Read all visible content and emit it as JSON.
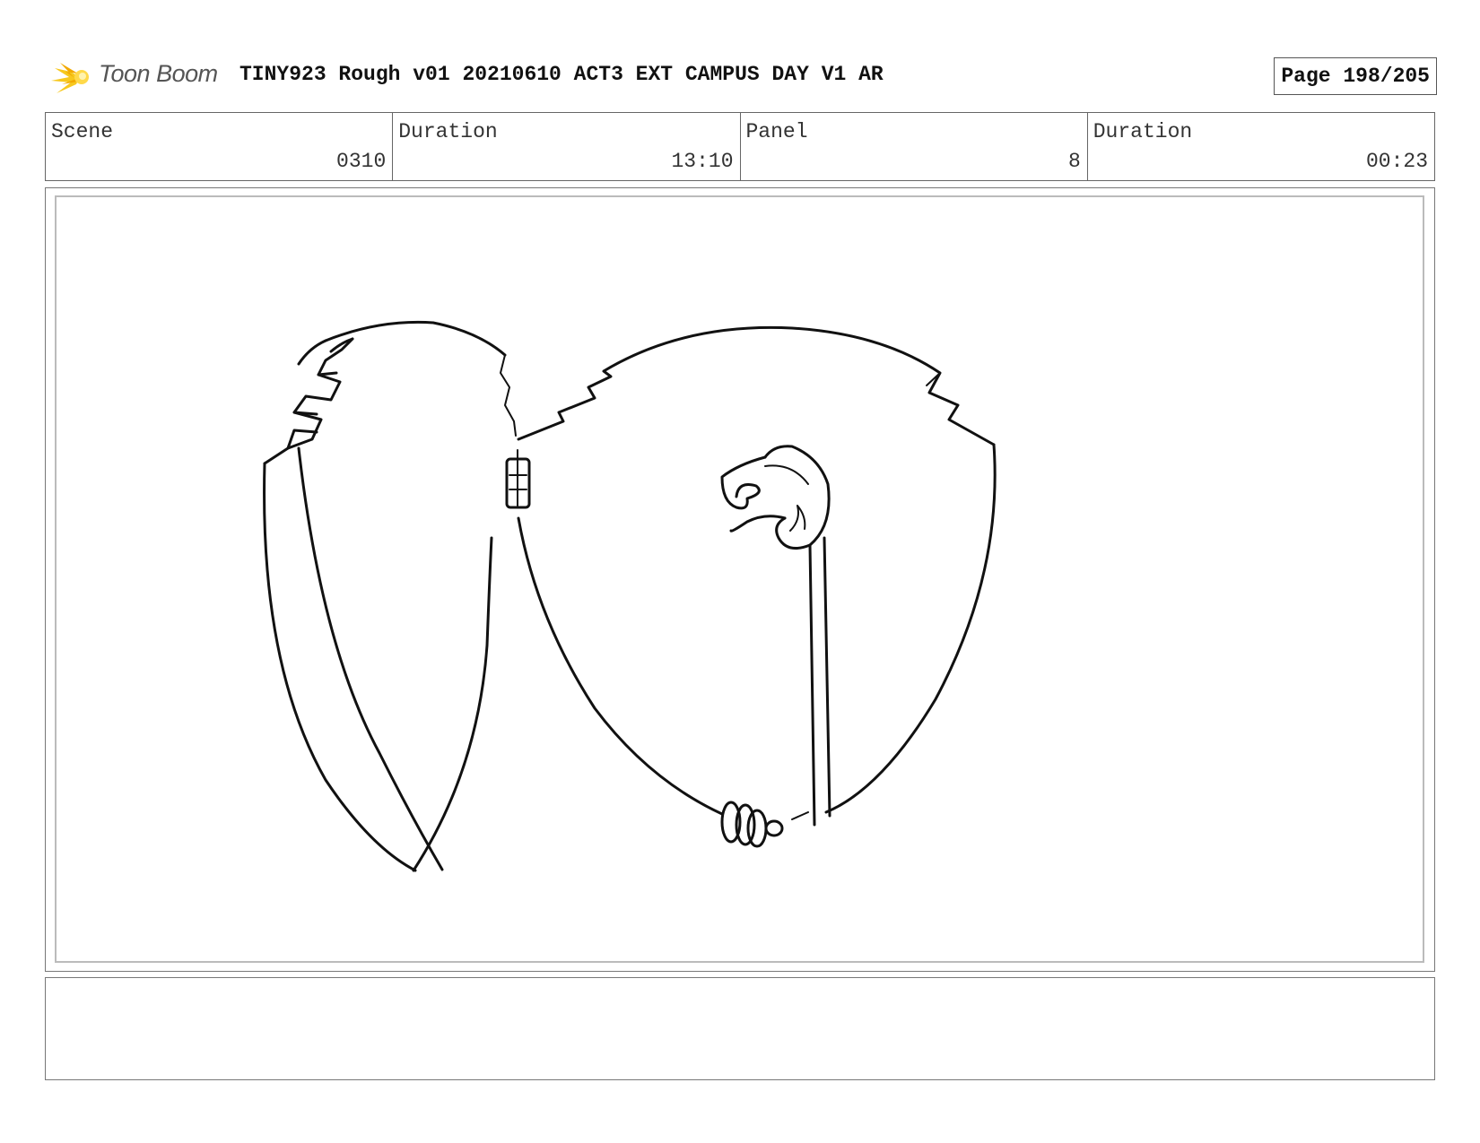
{
  "header": {
    "logo_text": "Toon Boom",
    "logo_icon": "toon-boom-star-icon",
    "title": "TINY923 Rough v01 20210610 ACT3 EXT CAMPUS DAY V1 AR",
    "page": "Page 198/205"
  },
  "info": {
    "scene_label": "Scene",
    "scene_value": "0310",
    "scene_duration_label": "Duration",
    "scene_duration_value": "13:10",
    "panel_label": "Panel",
    "panel_value": "8",
    "panel_duration_label": "Duration",
    "panel_duration_value": "00:23"
  },
  "panel": {
    "image": "rough-sketch-two-cracked-shell-halves"
  },
  "notes": {
    "text": ""
  },
  "colors": {
    "logo_yellow": "#f5c400",
    "line": "#111111",
    "frame": "#777777"
  }
}
